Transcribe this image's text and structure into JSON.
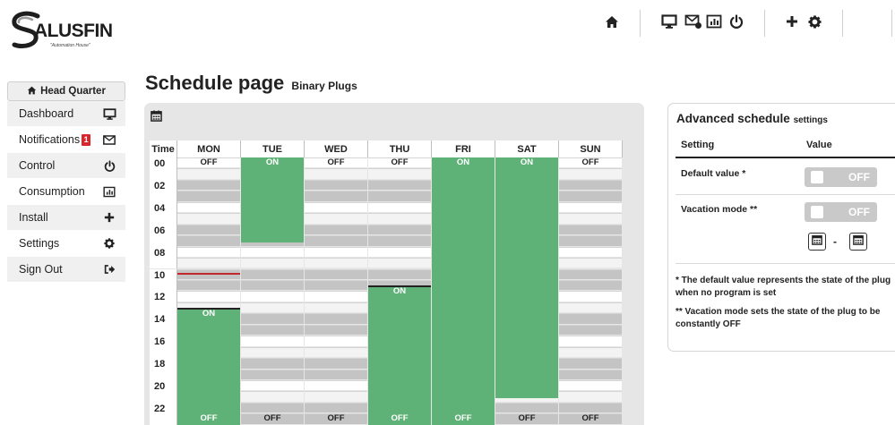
{
  "header": {
    "logo_brand": "ALUSFIN",
    "logo_tagline": "\"Automation House\"",
    "icons": [
      "home-icon",
      "monitor-icon",
      "mail-settings-icon",
      "chart-icon",
      "power-icon",
      "plus-icon",
      "gear-icon"
    ]
  },
  "sidebar": {
    "headquarter_label": "Head Quarter",
    "items": [
      {
        "label": "Dashboard",
        "icon": "monitor-icon"
      },
      {
        "label": "Notifications",
        "badge": "1",
        "icon": "mail-icon"
      },
      {
        "label": "Control",
        "icon": "power-icon"
      },
      {
        "label": "Consumption",
        "icon": "chart-icon"
      },
      {
        "label": "Install",
        "icon": "plus-icon"
      },
      {
        "label": "Settings",
        "icon": "gear-icon"
      },
      {
        "label": "Sign Out",
        "icon": "sign-out-icon"
      }
    ]
  },
  "page": {
    "title": "Schedule page",
    "subtitle": "Binary Plugs"
  },
  "schedule": {
    "time_header": "Time",
    "days": [
      "MON",
      "TUE",
      "WED",
      "THU",
      "FRI",
      "SAT",
      "SUN"
    ],
    "hours": [
      "00",
      "02",
      "04",
      "06",
      "08",
      "10",
      "12",
      "14",
      "16",
      "18",
      "20",
      "22"
    ],
    "on_color": "#5fb277",
    "blocks": [
      {
        "day": 1,
        "start": 0,
        "end": 7.6
      },
      {
        "day": 3,
        "start": 11.6,
        "end": 24
      },
      {
        "day": 4,
        "start": 0,
        "end": 24
      },
      {
        "day": 5,
        "start": 0,
        "end": 21.6
      },
      {
        "day": 0,
        "start": 13.6,
        "end": 24
      }
    ],
    "labels": [
      {
        "day": 0,
        "hour": 0,
        "text": "OFF",
        "state": "off"
      },
      {
        "day": 1,
        "hour": 0,
        "text": "ON",
        "state": "on"
      },
      {
        "day": 2,
        "hour": 0,
        "text": "OFF",
        "state": "off"
      },
      {
        "day": 3,
        "hour": 0,
        "text": "OFF",
        "state": "off"
      },
      {
        "day": 4,
        "hour": 0,
        "text": "ON",
        "state": "on"
      },
      {
        "day": 5,
        "hour": 0,
        "text": "ON",
        "state": "on"
      },
      {
        "day": 6,
        "hour": 0,
        "text": "OFF",
        "state": "off"
      },
      {
        "day": 3,
        "hour": 11.6,
        "text": "ON",
        "state": "on"
      },
      {
        "day": 0,
        "hour": 13.6,
        "text": "ON",
        "state": "on"
      },
      {
        "day": 0,
        "hour": 23,
        "text": "OFF",
        "state": "on"
      },
      {
        "day": 1,
        "hour": 23,
        "text": "OFF",
        "state": "off"
      },
      {
        "day": 2,
        "hour": 23,
        "text": "OFF",
        "state": "off"
      },
      {
        "day": 3,
        "hour": 23,
        "text": "OFF",
        "state": "on"
      },
      {
        "day": 4,
        "hour": 23,
        "text": "OFF",
        "state": "on"
      },
      {
        "day": 5,
        "hour": 23,
        "text": "OFF",
        "state": "off"
      },
      {
        "day": 6,
        "hour": 23,
        "text": "OFF",
        "state": "off"
      }
    ],
    "dividers": [
      {
        "day": 3,
        "hour": 11.6
      },
      {
        "day": 0,
        "hour": 13.6
      }
    ],
    "current_time_marker": {
      "day": 0,
      "hour": 10.4,
      "color": "#c0282d"
    }
  },
  "advanced": {
    "title": "Advanced schedule",
    "title_sub": "settings",
    "col_setting": "Setting",
    "col_value": "Value",
    "settings": [
      {
        "label": "Default value *",
        "value": "OFF"
      },
      {
        "label": "Vacation mode **",
        "value": "OFF"
      }
    ],
    "date_separator": "-",
    "note1": "* The default value represents the state of the plug when no program is set",
    "note2": "** Vacation mode sets the state of the plug to be constantly OFF"
  }
}
